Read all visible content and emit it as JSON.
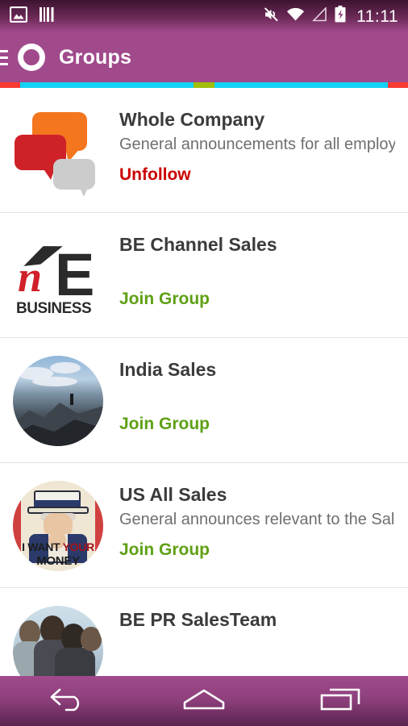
{
  "statusbar": {
    "time": "11:11",
    "left_icons": [
      "image-icon",
      "barcode-icon"
    ],
    "right_icons": [
      "mute-icon",
      "wifi-icon",
      "signal-icon",
      "battery-charging-icon"
    ]
  },
  "appbar": {
    "menu_icon": "hamburger-menu-icon",
    "logo_icon": "app-logo-ring-icon",
    "title": "Groups",
    "background_color": "#a04a8c"
  },
  "accent_strip": {
    "segments": [
      {
        "color": "#f93b33",
        "width_pct": 5.0
      },
      {
        "color": "#14d2f5",
        "width_pct": 42.5
      },
      {
        "color": "#a0bd09",
        "width_pct": 5.0
      },
      {
        "color": "#14d2f5",
        "width_pct": 42.5
      },
      {
        "color": "#f93b33",
        "width_pct": 5.0
      }
    ]
  },
  "colors": {
    "unfollow": "#cc0000",
    "join": "#5fa015",
    "title": "#3b3b3b",
    "description": "#6f6f6f",
    "divider": "#e3e3e3"
  },
  "groups": [
    {
      "name": "Whole Company",
      "description": "General announcements for all employ…",
      "action": "Unfollow",
      "action_type": "unfollow",
      "avatar": "speech-bubbles-icon"
    },
    {
      "name": "BE Channel Sales",
      "description": "",
      "action": "Join Group",
      "action_type": "join",
      "avatar": "be-business-logo",
      "logo_text": {
        "letter_n": "n",
        "letter_e": "E",
        "wordmark": "BUSINESS"
      }
    },
    {
      "name": "India Sales",
      "description": "",
      "action": "Join Group",
      "action_type": "join",
      "avatar": "mountain-photo"
    },
    {
      "name": "US All Sales",
      "description": "General announces relevant to the Sal…",
      "action": "Join Group",
      "action_type": "join",
      "avatar": "uncle-sam-poster",
      "poster_text": {
        "line1_a": "I WANT ",
        "line1_b": "YOUR",
        "line2": "MONEY"
      }
    },
    {
      "name": "BE PR SalesTeam",
      "description": "",
      "action": "",
      "action_type": "",
      "avatar": "team-photo"
    }
  ],
  "navbar": {
    "back": "back-icon",
    "home": "home-icon",
    "recents": "recents-icon"
  }
}
